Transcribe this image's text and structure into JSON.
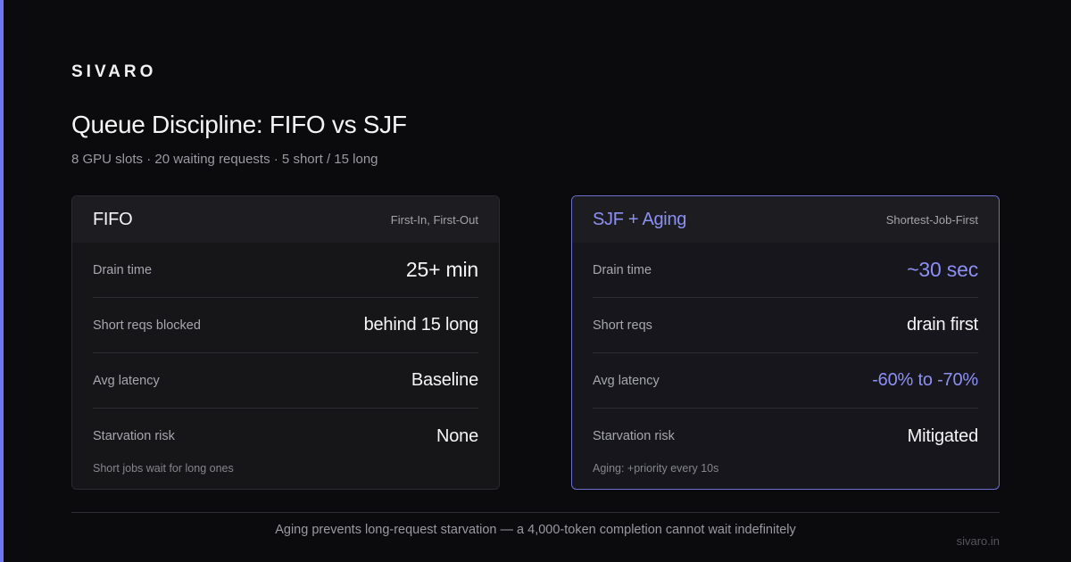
{
  "brand": "SIVARO",
  "title": "Queue Discipline: FIFO vs SJF",
  "subtitle": "8 GPU slots · 20 waiting requests · 5 short / 15 long",
  "colors": {
    "accent": "#6f76f0",
    "accent_text": "#8c90f4",
    "background": "#0b0b0d"
  },
  "cards": {
    "fifo": {
      "name": "FIFO",
      "tag": "First-In, First-Out",
      "rows": [
        {
          "label": "Drain time",
          "value": "25+ min"
        },
        {
          "label": "Short reqs blocked",
          "value": "behind 15 long"
        },
        {
          "label": "Avg latency",
          "value": "Baseline"
        },
        {
          "label": "Starvation risk",
          "value": "None"
        }
      ],
      "note": "Short jobs wait for long ones"
    },
    "sjf": {
      "name": "SJF + Aging",
      "tag": "Shortest-Job-First",
      "rows": [
        {
          "label": "Drain time",
          "value": "~30 sec"
        },
        {
          "label": "Short reqs",
          "value": "drain first"
        },
        {
          "label": "Avg latency",
          "value": "-60% to -70%"
        },
        {
          "label": "Starvation risk",
          "value": "Mitigated"
        }
      ],
      "note": "Aging: +priority every 10s"
    }
  },
  "footer": "Aging prevents long-request starvation — a 4,000-token completion cannot wait indefinitely",
  "site": "sivaro.in"
}
